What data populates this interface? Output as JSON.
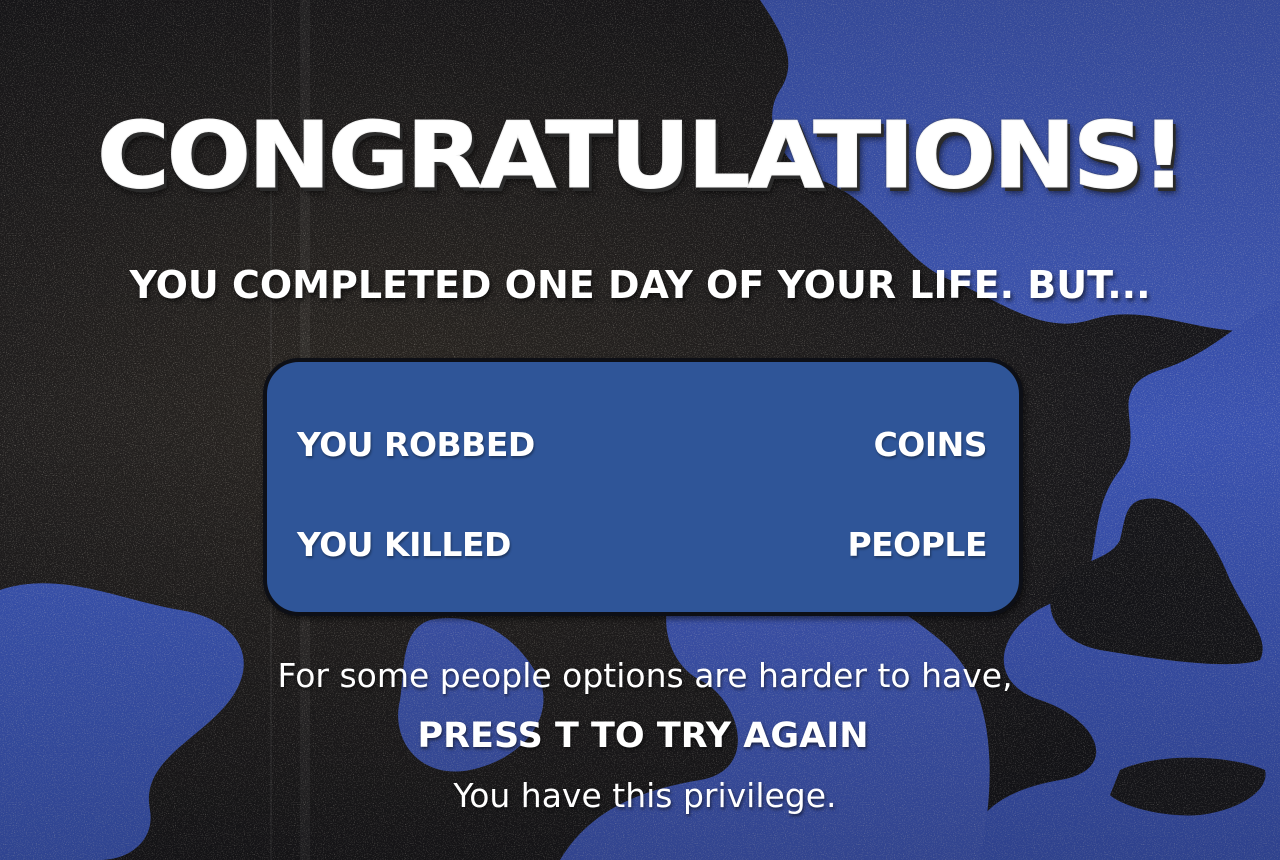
{
  "screen": {
    "title": "CONGRATULATIONS!",
    "subtitle": "YOU COMPLETED ONE DAY OF YOUR LIFE. BUT...",
    "stats": {
      "robbed_label": "YOU ROBBED",
      "robbed_unit": "COINS",
      "killed_label": "YOU KILLED",
      "killed_unit": "PEOPLE"
    },
    "footer": {
      "line1": "For some people options are harder to have,",
      "line2": "PRESS T TO TRY AGAIN",
      "line3": "You have this privilege."
    }
  },
  "colors": {
    "panel": "#2f5598",
    "panel_border": "#0d0f16",
    "text": "#ffffff",
    "background_blue": "#3c56b8",
    "background_dark": "#1e1c22"
  }
}
